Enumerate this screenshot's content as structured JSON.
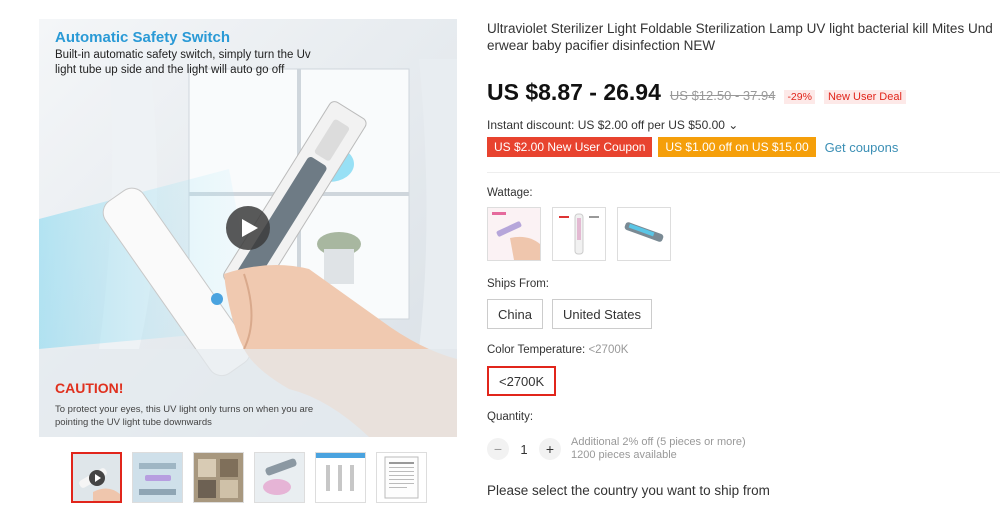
{
  "gallery": {
    "main_image": {
      "title": "Automatic Safety Switch",
      "description": "Built-in automatic safety switch, simply turn the Uv light tube up side and the light will auto go off",
      "caution_title": "CAUTION!",
      "caution_text": "To protect your eyes, this UV light only turns on when you are pointing the UV light tube downwards"
    },
    "thumbnail_count": 6,
    "active_thumbnail": 1
  },
  "product": {
    "title_line1": "Ultraviolet Sterilizer Light Foldable Sterilization Lamp UV light bacterial kill Mites Und",
    "title_line2": "erwear baby pacifier disinfection NEW",
    "price": "US $8.87 - 26.94",
    "original_price": "US $12.50 - 37.94",
    "discount_badge": "-29%",
    "new_user_badge": "New User Deal",
    "instant_discount": "Instant discount: US $2.00 off per US $50.00 ⌄",
    "coupons": [
      {
        "label": "US $2.00 New User Coupon",
        "color": "#e8432f"
      },
      {
        "label": "US $1.00 off on US $15.00",
        "color": "#f59f0a"
      }
    ],
    "get_coupons": "Get coupons"
  },
  "options": {
    "wattage_label": "Wattage:",
    "wattage_count": 3,
    "ships_from_label": "Ships From:",
    "ships_from": [
      "China",
      "United States"
    ],
    "color_temp_label": "Color Temperature:",
    "color_temp_selected": "<2700K",
    "color_temp_values": [
      "<2700K"
    ]
  },
  "quantity": {
    "label": "Quantity:",
    "minus": "−",
    "value": "1",
    "plus": "+",
    "extra_discount": "Additional 2% off (5 pieces or more)",
    "available": "1200 pieces available"
  },
  "shipping_message": "Please select the country you want to ship from",
  "colors": {
    "price_red": "#e1251b",
    "coupon_red": "#e8432f",
    "coupon_orange": "#f59f0a",
    "link_blue": "#3b8fb5",
    "image_title_blue": "#2a9ad6"
  }
}
